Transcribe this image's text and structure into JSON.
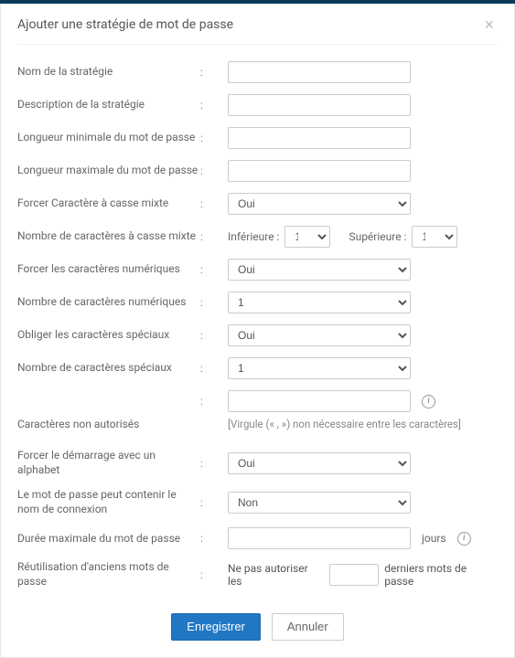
{
  "modal": {
    "title": "Ajouter une stratégie de mot de passe",
    "close_label": "×"
  },
  "rows": {
    "policy_name": {
      "label": "Nom de la stratégie",
      "value": ""
    },
    "policy_desc": {
      "label": "Description de la stratégie",
      "value": ""
    },
    "min_len": {
      "label": "Longueur minimale du mot de passe",
      "value": ""
    },
    "max_len": {
      "label": "Longueur maximale du mot de passe",
      "value": ""
    },
    "force_mixed": {
      "label": "Forcer Caractère à casse mixte",
      "value": "Oui"
    },
    "mixed_count": {
      "label": "Nombre de caractères à casse mixte",
      "lower_label": "Inférieure :",
      "lower_value": "1",
      "upper_label": "Supérieure :",
      "upper_value": "1"
    },
    "force_numeric": {
      "label": "Forcer les caractères numériques",
      "value": "Oui"
    },
    "numeric_count": {
      "label": "Nombre de caractères numériques",
      "value": "1"
    },
    "force_special": {
      "label": "Obliger les caractères spéciaux",
      "value": "Oui"
    },
    "special_count": {
      "label": "Nombre de caractères spéciaux",
      "value": "1"
    },
    "disallowed": {
      "label": "Caractères non autorisés",
      "value": "",
      "hint": "[Virgule (« , ») non nécessaire entre les caractères]"
    },
    "start_alpha": {
      "label": "Forcer le démarrage avec un alphabet",
      "value": "Oui"
    },
    "contain_login": {
      "label": "Le mot de passe peut contenir le nom de connexion",
      "value": "Non"
    },
    "max_age": {
      "label": "Durée maximale du mot de passe",
      "value": "",
      "suffix": "jours"
    },
    "reuse": {
      "label": "Réutilisation d'anciens mots de passe",
      "prefix_text": "Ne pas autoriser les",
      "value": "",
      "suffix_text": "derniers mots de passe"
    }
  },
  "options": {
    "yes": "Oui",
    "no": "Non",
    "one": "1"
  },
  "footer": {
    "save": "Enregistrer",
    "cancel": "Annuler"
  }
}
